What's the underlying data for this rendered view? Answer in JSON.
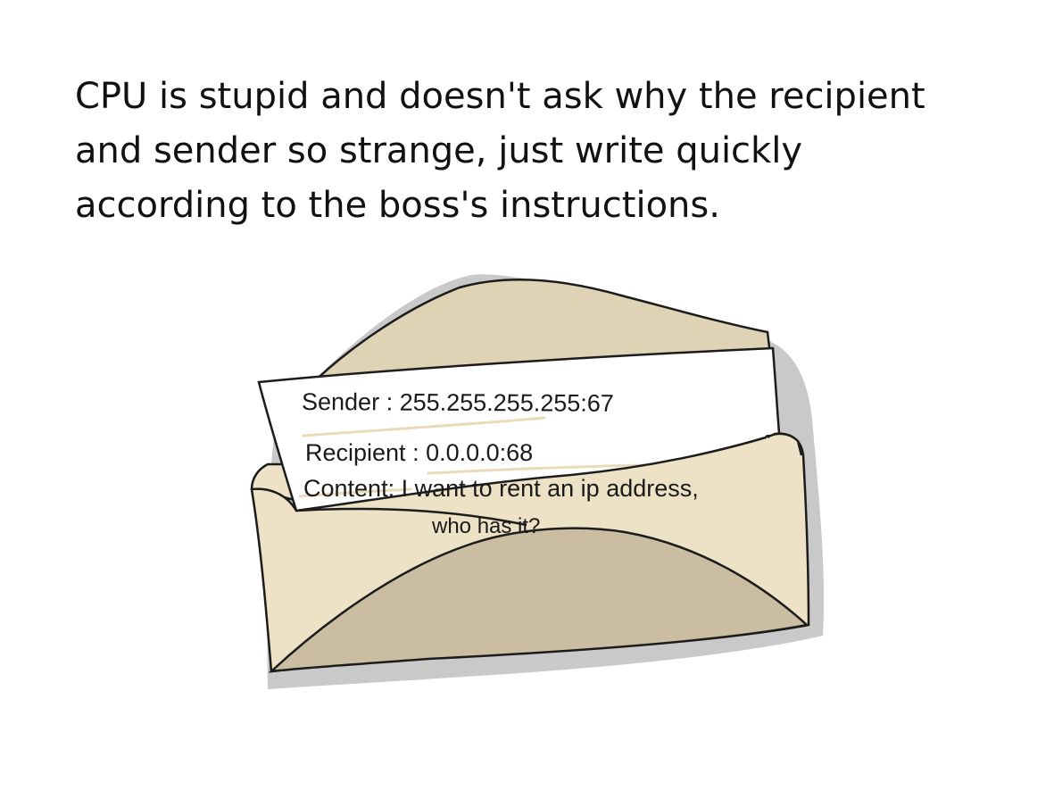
{
  "caption": {
    "lines": [
      "CPU is stupid and doesn't ask why the recipient",
      "and sender so strange, just write quickly",
      "according to the boss's instructions."
    ]
  },
  "letter": {
    "sender_line": "Sender : 255.255.255.255:67",
    "recipient_line": "Recipient : 0.0.0.0:68",
    "content_line_1": "Content:  I want to rent an ip address,",
    "content_line_2": "who has it?"
  },
  "colors": {
    "shadow": "#c9c9c9",
    "envelope_body": "#ede1c6",
    "envelope_back_flap": "#dfd3b5",
    "envelope_bottom_flap": "#cbbda2",
    "outline": "#1c1c1c",
    "paper": "#ffffff",
    "paper_highlight": "#eadbb8"
  },
  "icons": {
    "envelope": "open-envelope-illustration"
  }
}
